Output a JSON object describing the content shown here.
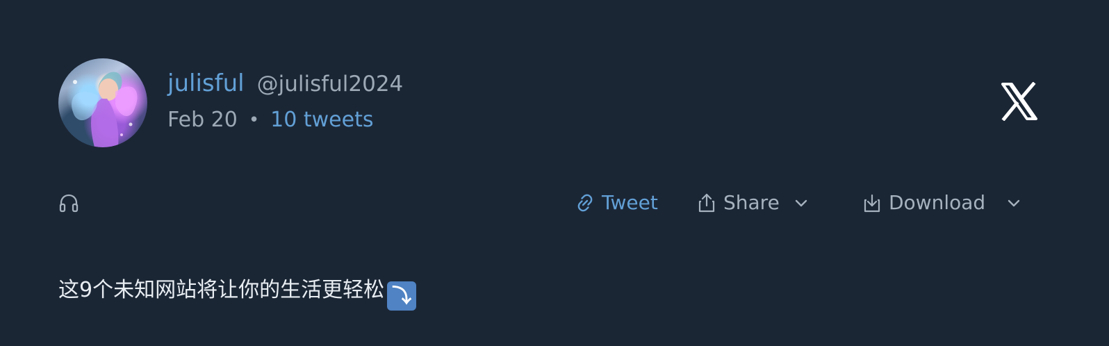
{
  "author": {
    "display_name": "julisful",
    "handle": "@julisful2024",
    "date": "Feb 20",
    "separator": "•",
    "tweet_count": "10 tweets",
    "avatar_icon": "fairy-avatar-image"
  },
  "platform": {
    "logo_icon": "x-logo-icon"
  },
  "toolbar": {
    "audio_icon": "headphones-icon",
    "tweet_label": "Tweet",
    "share_label": "Share",
    "download_label": "Download"
  },
  "content": {
    "text": "这9个未知网站将让你的生活更轻松",
    "emoji": "⤵"
  },
  "colors": {
    "background": "#1b2635",
    "accent": "#62a0d6",
    "muted": "#9daab6",
    "content_text": "#e8edf2"
  }
}
